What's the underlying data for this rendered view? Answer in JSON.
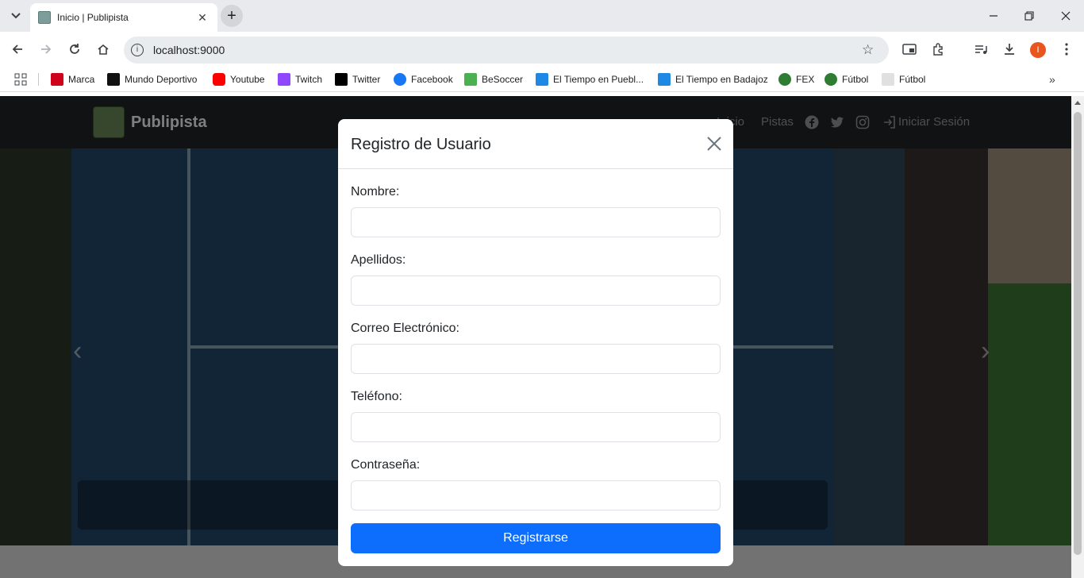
{
  "browser": {
    "tab_title": "Inicio | Publipista",
    "url": "localhost:9000",
    "profile_initial": "I",
    "bookmarks": [
      {
        "label": "Marca",
        "icon": "marca-icon",
        "color": "#d0021b"
      },
      {
        "label": "Mundo Deportivo",
        "icon": "mundo-deportivo-icon",
        "color": "#111111"
      },
      {
        "label": "Youtube",
        "icon": "youtube-icon",
        "color": "#ff0000"
      },
      {
        "label": "Twitch",
        "icon": "twitch-icon",
        "color": "#9146ff"
      },
      {
        "label": "Twitter",
        "icon": "x-icon",
        "color": "#000000"
      },
      {
        "label": "Facebook",
        "icon": "facebook-icon",
        "color": "#1877f2"
      },
      {
        "label": "BeSoccer",
        "icon": "besoccer-icon",
        "color": "#4caf50"
      },
      {
        "label": "El Tiempo en Puebl...",
        "icon": "eltiempo-icon",
        "color": "#1e88e5"
      },
      {
        "label": "El Tiempo en Badajoz",
        "icon": "eltiempo-icon",
        "color": "#1e88e5"
      },
      {
        "label": "FEX",
        "icon": "fex-icon",
        "color": "#2e7d32"
      },
      {
        "label": "Fútbol",
        "icon": "football-icon",
        "color": "#2e7d32"
      },
      {
        "label": "Fútbol",
        "icon": "page-icon",
        "color": "#cccccc"
      }
    ]
  },
  "site": {
    "brand": "Publipista",
    "nav": {
      "inicio": "Inicio",
      "pistas": "Pistas",
      "login": "Iniciar Sesión"
    }
  },
  "modal": {
    "title": "Registro de Usuario",
    "fields": [
      {
        "label": "Nombre:",
        "value": ""
      },
      {
        "label": "Apellidos:",
        "value": ""
      },
      {
        "label": "Correo Electrónico:",
        "value": ""
      },
      {
        "label": "Teléfono:",
        "value": ""
      },
      {
        "label": "Contraseña:",
        "value": ""
      }
    ],
    "submit_label": "Registrarse"
  },
  "colors": {
    "primary": "#0d6efd",
    "navbar": "#212529"
  }
}
